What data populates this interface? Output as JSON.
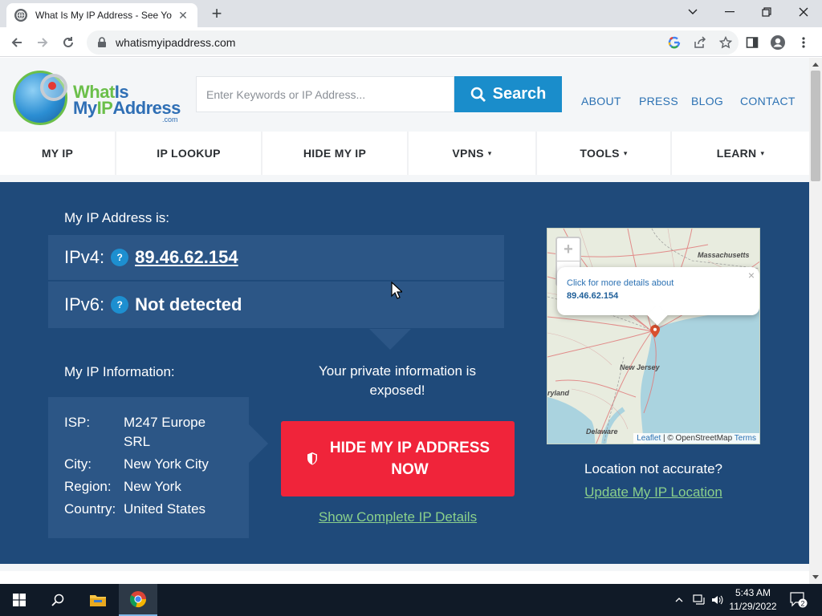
{
  "browser": {
    "tab_title": "What Is My IP Address - See Your",
    "url": "whatismyipaddress.com"
  },
  "site": {
    "logo": {
      "line1_a": "What",
      "line1_b": "Is",
      "line2_a": "My",
      "line2_b": "IP",
      "line2_c": "Address",
      "line3": ".com"
    },
    "search_placeholder": "Enter Keywords or IP Address...",
    "search_label": "Search",
    "top_links": [
      "ABOUT",
      "PRESS",
      "BLOG",
      "CONTACT"
    ],
    "nav": [
      {
        "label": "MY IP",
        "dropdown": false
      },
      {
        "label": "IP LOOKUP",
        "dropdown": false
      },
      {
        "label": "HIDE MY IP",
        "dropdown": false
      },
      {
        "label": "VPNS",
        "dropdown": true
      },
      {
        "label": "TOOLS",
        "dropdown": true
      },
      {
        "label": "LEARN",
        "dropdown": true
      }
    ],
    "caret": "▾"
  },
  "hero": {
    "ip_heading": "My IP Address is:",
    "ipv4_label": "IPv4:",
    "ipv4_value": "89.46.62.154",
    "ipv6_label": "IPv6:",
    "ipv6_value": "Not detected",
    "help_glyph": "?",
    "info_heading": "My IP Information:",
    "info": [
      {
        "key": "ISP:",
        "value": "M247 Europe SRL"
      },
      {
        "key": "City:",
        "value": "New York City"
      },
      {
        "key": "Region:",
        "value": "New York"
      },
      {
        "key": "Country:",
        "value": "United States"
      }
    ],
    "exposed_text": "Your private information is exposed!",
    "hide_button_line1": "HIDE MY IP ADDRESS",
    "hide_button_line2": "NOW",
    "complete_details_link": "Show Complete IP Details",
    "map": {
      "zoom_in": "+",
      "zoom_out": "−",
      "popup_text": "Click for more details about",
      "popup_ip": "89.46.62.154",
      "popup_close": "×",
      "labels": {
        "massachusetts": "Massachusetts",
        "new_jersey": "New Jersey",
        "maryland": "ryland",
        "delaware": "Delaware"
      },
      "attribution_leaflet": "Leaflet",
      "attribution_sep": " | © ",
      "attribution_osm": "OpenStreetMap",
      "attribution_terms": "Terms"
    },
    "not_accurate": "Location not accurate?",
    "update_link": "Update My IP Location"
  },
  "taskbar": {
    "time": "5:43 AM",
    "date": "11/29/2022",
    "notification_count": "2"
  },
  "colors": {
    "hero_bg": "#1f4a7a",
    "panel_bg": "#2c5686",
    "accent_blue": "#1a8dcb",
    "cta_red": "#f0243a",
    "link_green": "#8bd08b"
  }
}
